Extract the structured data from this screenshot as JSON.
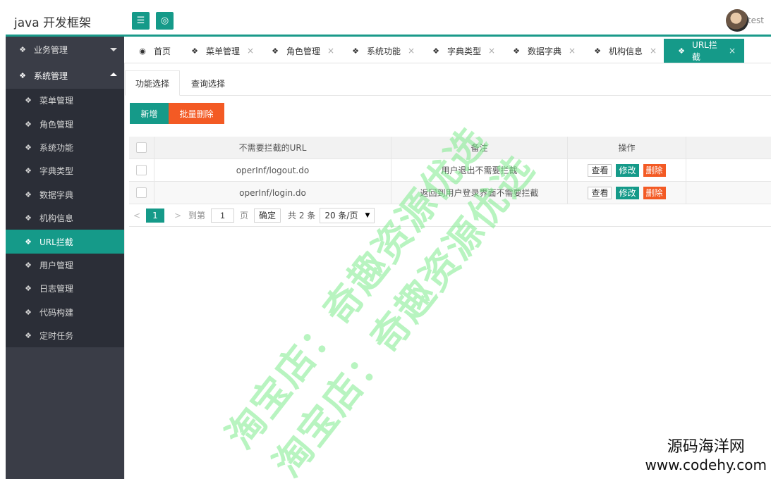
{
  "header": {
    "title": "java 开发框架",
    "menu_icon": "☰",
    "globe_icon": "◎",
    "username": "test"
  },
  "sidebar": {
    "groups": [
      {
        "label": "业务管理",
        "expanded": false
      },
      {
        "label": "系统管理",
        "expanded": true
      }
    ],
    "items": [
      {
        "label": "菜单管理"
      },
      {
        "label": "角色管理"
      },
      {
        "label": "系统功能"
      },
      {
        "label": "字典类型"
      },
      {
        "label": "数据字典"
      },
      {
        "label": "机构信息"
      },
      {
        "label": "URL拦截",
        "active": true
      },
      {
        "label": "用户管理"
      },
      {
        "label": "日志管理"
      },
      {
        "label": "代码构建"
      },
      {
        "label": "定时任务"
      }
    ]
  },
  "tabs": [
    {
      "label": "首页",
      "closable": false
    },
    {
      "label": "菜单管理",
      "closable": true
    },
    {
      "label": "角色管理",
      "closable": true
    },
    {
      "label": "系统功能",
      "closable": true
    },
    {
      "label": "字典类型",
      "closable": true
    },
    {
      "label": "数据字典",
      "closable": true
    },
    {
      "label": "机构信息",
      "closable": true
    },
    {
      "label": "URL拦截",
      "closable": true,
      "active": true
    }
  ],
  "close_glyph": "×",
  "subtabs": [
    "功能选择",
    "查询选择"
  ],
  "toolbar": {
    "add_label": "新增",
    "batch_delete_label": "批量删除"
  },
  "table": {
    "headers": [
      "不需要拦截的URL",
      "备注",
      "操作"
    ],
    "rows": [
      {
        "url": "operInf/logout.do",
        "remark": "用户退出不需要拦截"
      },
      {
        "url": "operInf/login.do",
        "remark": "返回到用户登录界面不需要拦截"
      }
    ],
    "actions": {
      "view": "查看",
      "edit": "修改",
      "delete": "删除"
    }
  },
  "pager": {
    "prev": "<",
    "current": "1",
    "next": ">",
    "goto_label": "到第",
    "goto_value": "1",
    "page_unit": "页",
    "confirm": "确定",
    "total": "共 2 条",
    "page_size": "20 条/页",
    "page_size_arrow": "▼"
  },
  "watermark": {
    "line1": "淘宝店：奇趣资源优选",
    "line2": "淘宝店：奇趣资源优选"
  },
  "corner": {
    "site_name": "源码海洋网",
    "site_url": "www.codehy.com"
  },
  "colors": {
    "accent": "#159a89",
    "danger": "#f35a24",
    "sidebar": "#3a3d47",
    "sidebar_sub": "#2b2e37"
  }
}
